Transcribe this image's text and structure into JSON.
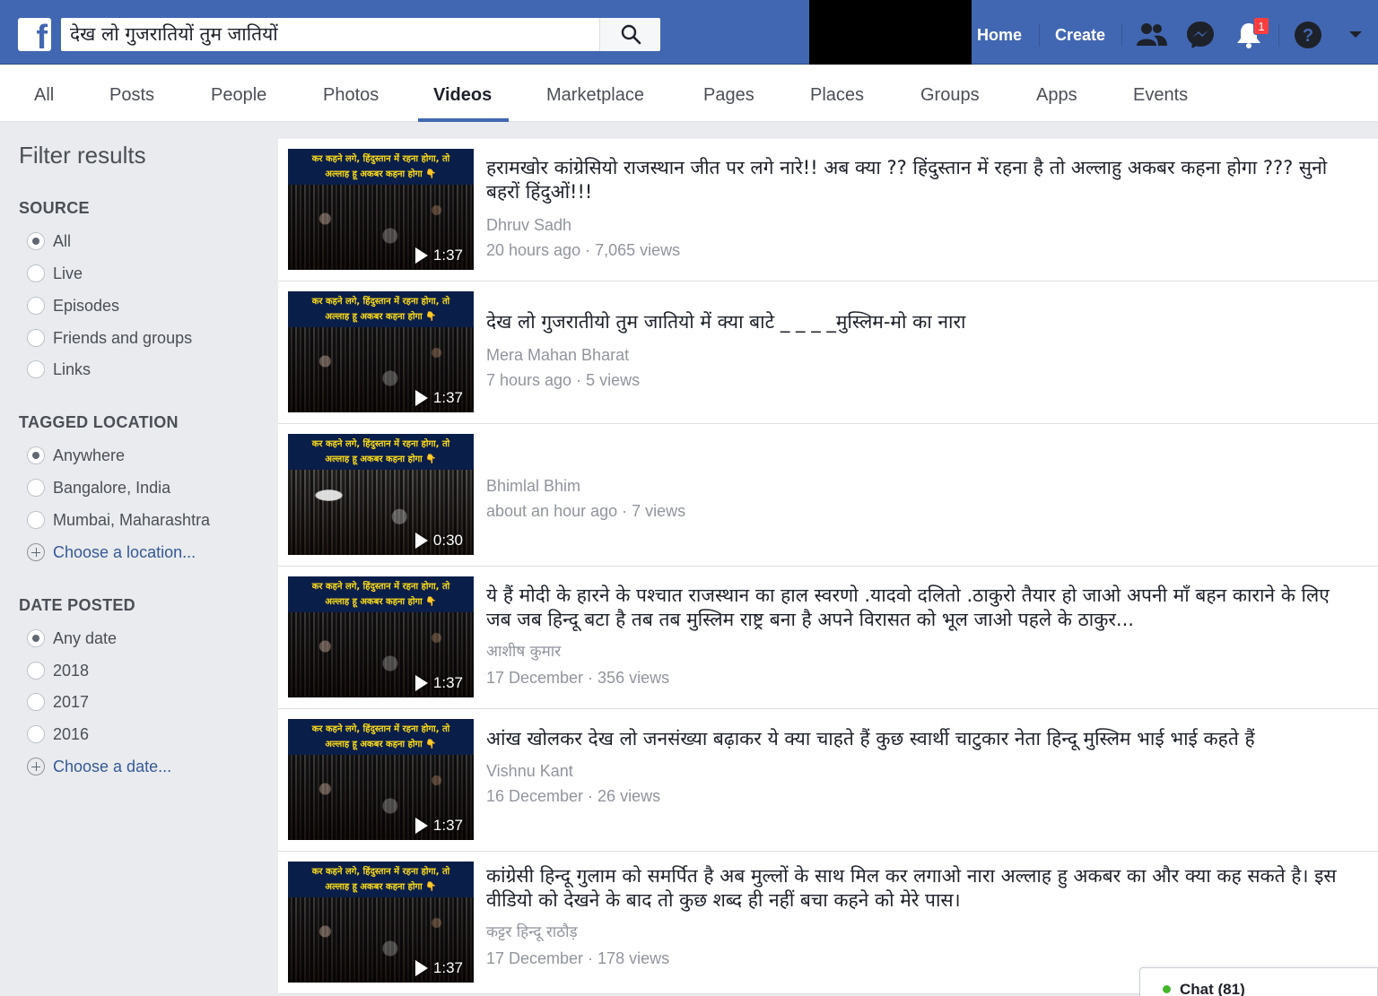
{
  "search": {
    "query": "देख लो गुजरातियों तुम जातियों"
  },
  "header": {
    "home": "Home",
    "create": "Create",
    "notification_count": "1"
  },
  "tabs": [
    {
      "label": "All"
    },
    {
      "label": "Posts"
    },
    {
      "label": "People"
    },
    {
      "label": "Photos"
    },
    {
      "label": "Videos",
      "active": true
    },
    {
      "label": "Marketplace"
    },
    {
      "label": "Pages"
    },
    {
      "label": "Places"
    },
    {
      "label": "Groups"
    },
    {
      "label": "Apps"
    },
    {
      "label": "Events"
    }
  ],
  "filters": {
    "title": "Filter results",
    "source": {
      "title": "SOURCE",
      "options": [
        "All",
        "Live",
        "Episodes",
        "Friends and groups",
        "Links"
      ],
      "selected": "All"
    },
    "location": {
      "title": "TAGGED LOCATION",
      "options": [
        "Anywhere",
        "Bangalore, India",
        "Mumbai, Maharashtra"
      ],
      "selected": "Anywhere",
      "choose": "Choose a location..."
    },
    "date": {
      "title": "DATE POSTED",
      "options": [
        "Any date",
        "2018",
        "2017",
        "2016"
      ],
      "selected": "Any date",
      "choose": "Choose a date..."
    }
  },
  "thumbnail_caption": [
    "कर कहने लगे, हिंदुस्तान में रहना होगा, तो",
    "अल्लाह हू अकबर कहना होगा 👇"
  ],
  "results": [
    {
      "title": "हरामखोर कांग्रेसियो राजस्थान जीत पर लगे नारे!! अब क्या ?? हिंदुस्तान में रहना है तो अल्लाहु अकबर कहना होगा ??? सुनो बहरों हिंदुओं!!!",
      "author": "Dhruv Sadh",
      "meta": "20 hours ago · 7,065 views",
      "duration": "1:37"
    },
    {
      "title": "देख लो गुजरातीयो तुम जातियो में क्या बाटे _ _ _ _मुस्लिम-मो का नारा",
      "author": "Mera Mahan Bharat",
      "meta": "7 hours ago · 5 views",
      "duration": "1:37"
    },
    {
      "title": "",
      "author": "Bhimlal Bhim",
      "meta": "about an hour ago · 7 views",
      "duration": "0:30"
    },
    {
      "title": "ये हैं मोदी के हारने के पश्चात राजस्थान का हाल स्वरणो .यादवो दलितो .ठाकुरो तैयार हो जाओ अपनी माँ बहन काराने के लिए जब जब हिन्दू बटा है तब तब मुस्लिम राष्ट्र बना है अपने विरासत को भूल जाओ पहले के ठाकुर...",
      "author": "आशीष कुमार",
      "meta": "17 December · 356 views",
      "duration": "1:37"
    },
    {
      "title": "आंख खोलकर देख लो जनसंख्या बढ़ाकर ये क्या चाहते हैं कुछ स्वार्थी चाटुकार नेता हिन्दू मुस्लिम भाई भाई कहते हैं",
      "author": "Vishnu Kant",
      "meta": "16 December · 26 views",
      "duration": "1:37"
    },
    {
      "title": "कांग्रेसी हिन्दू गुलाम को समर्पित है अब मुल्लों के साथ मिल कर लगाओ नारा अल्लाह हु अकबर का और क्या कह सकते है। इस वीडियो को देखने के बाद तो कुछ शब्द ही नहीं बचा कहने को मेरे पास।",
      "author": "कट्टर हिन्दू राठौड़",
      "meta": "17 December · 178 views",
      "duration": "1:37"
    }
  ],
  "chat": {
    "label": "Chat (81)"
  },
  "colors": {
    "brand": "#4267b2",
    "link": "#365899",
    "badge": "#fa3e3e",
    "online": "#42b72a"
  }
}
